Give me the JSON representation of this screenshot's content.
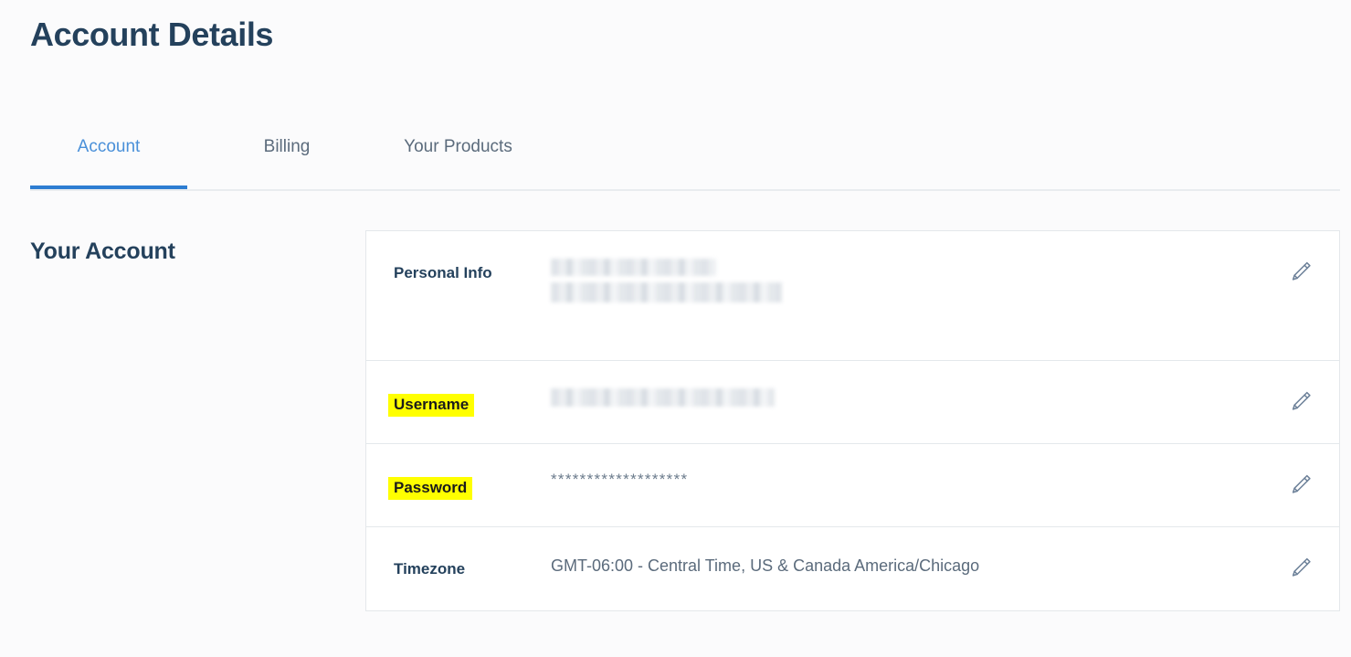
{
  "page": {
    "title": "Account Details",
    "background_color": "#fbfbfc",
    "heading_color": "#24415c"
  },
  "tabs": {
    "active_index": 0,
    "active_color": "#2d7dd2",
    "inactive_color": "#5b6b7c",
    "items": [
      {
        "label": "Account"
      },
      {
        "label": "Billing"
      },
      {
        "label": "Your Products"
      }
    ]
  },
  "section": {
    "title": "Your Account"
  },
  "card": {
    "highlight_color": "#ffff00",
    "rows": [
      {
        "label": "Personal Info",
        "highlighted": false,
        "value_type": "redacted-two-lines",
        "value": "",
        "edit_icon": "pencil-icon",
        "edit_label": "Edit Personal Info"
      },
      {
        "label": "Username",
        "highlighted": true,
        "value_type": "redacted-one-line",
        "value": "",
        "edit_icon": "pencil-icon",
        "edit_label": "Edit Username"
      },
      {
        "label": "Password",
        "highlighted": true,
        "value_type": "masked",
        "value": "*******************",
        "edit_icon": "pencil-icon",
        "edit_label": "Edit Password"
      },
      {
        "label": "Timezone",
        "highlighted": false,
        "value_type": "text",
        "value": "GMT-06:00 - Central Time, US & Canada America/Chicago",
        "edit_icon": "pencil-icon",
        "edit_label": "Edit Timezone"
      }
    ]
  }
}
